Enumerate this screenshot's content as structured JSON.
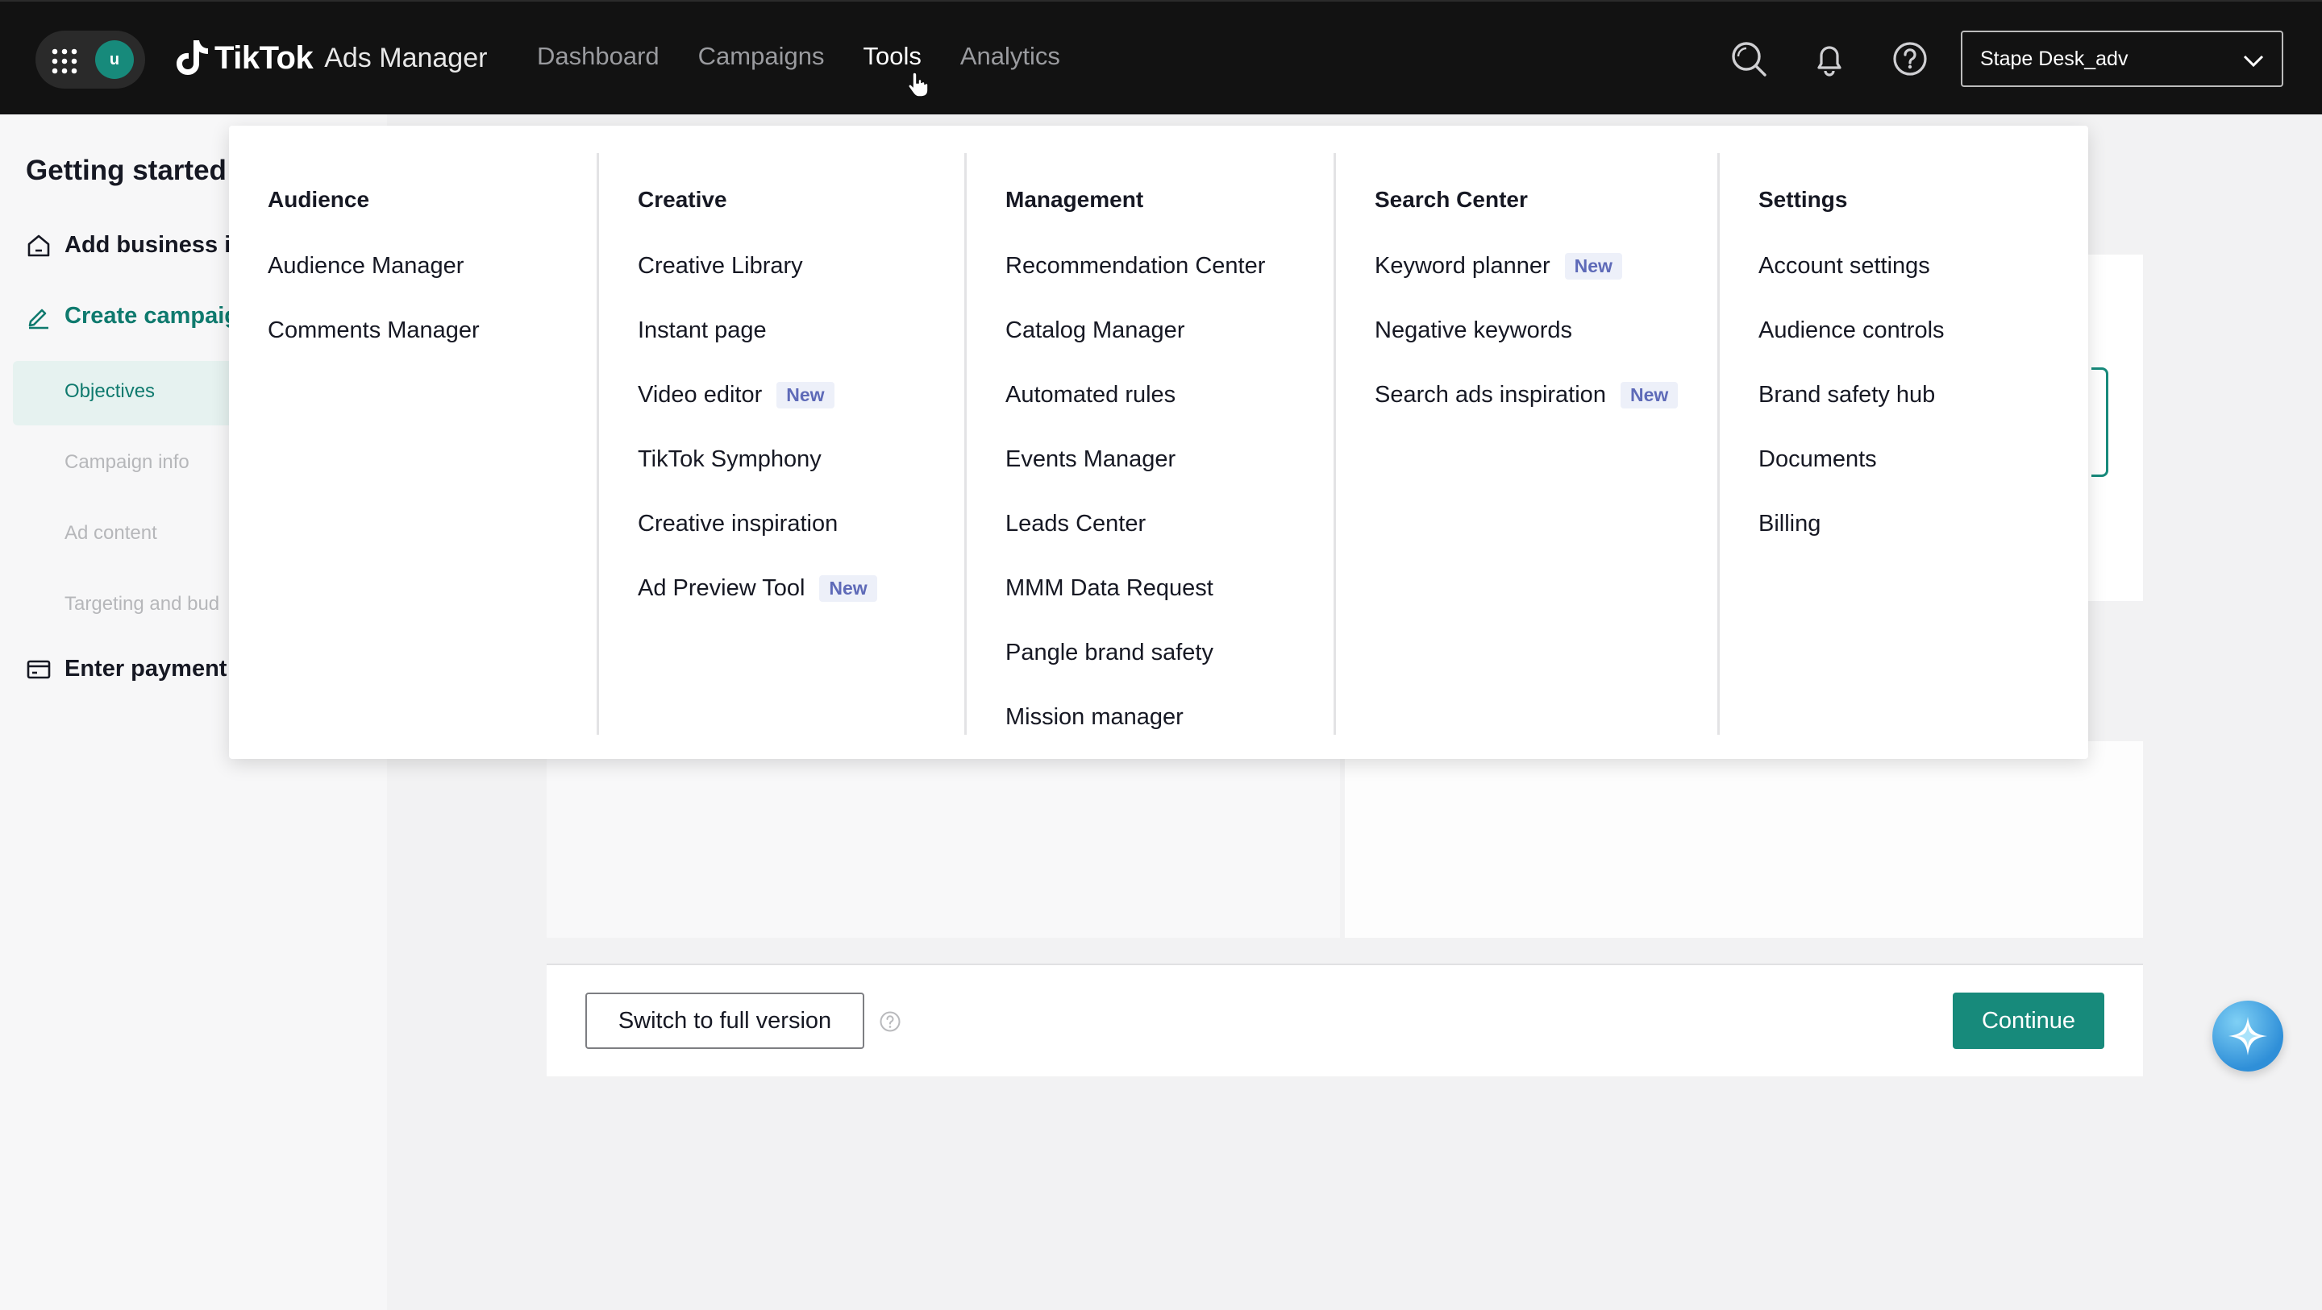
{
  "header": {
    "avatar_initial": "u",
    "brand": "TikTok",
    "product": "Ads Manager",
    "nav": [
      "Dashboard",
      "Campaigns",
      "Tools",
      "Analytics"
    ],
    "active_nav": "Tools",
    "account": "Stape Desk_adv"
  },
  "sidebar": {
    "title": "Getting started",
    "steps": [
      {
        "label": "Add business ir"
      },
      {
        "label": "Create campaig"
      },
      {
        "label": "Enter payment i"
      }
    ],
    "substeps": [
      "Objectives",
      "Campaign info",
      "Ad content",
      "Targeting and bud"
    ]
  },
  "footer": {
    "switch_label": "Switch to full version",
    "continue_label": "Continue"
  },
  "tools_menu": {
    "badge_label": "New",
    "columns": [
      {
        "heading": "Audience",
        "items": [
          "Audience Manager",
          "Comments Manager"
        ]
      },
      {
        "heading": "Creative",
        "items": [
          "Creative Library",
          "Instant page",
          "Video editor",
          "TikTok Symphony",
          "Creative inspiration",
          "Ad Preview Tool"
        ]
      },
      {
        "heading": "Management",
        "items": [
          "Recommendation Center",
          "Catalog Manager",
          "Automated rules",
          "Events Manager",
          "Leads Center",
          "MMM Data Request",
          "Pangle brand safety",
          "Mission manager"
        ]
      },
      {
        "heading": "Search Center",
        "items": [
          "Keyword planner",
          "Negative keywords",
          "Search ads inspiration"
        ]
      },
      {
        "heading": "Settings",
        "items": [
          "Account settings",
          "Audience controls",
          "Brand safety hub",
          "Documents",
          "Billing"
        ]
      }
    ]
  },
  "colors": {
    "topbar": "#121212",
    "accent": "#178a7b",
    "badge_bg": "#edf0f9",
    "badge_text": "#5e6ab8"
  }
}
